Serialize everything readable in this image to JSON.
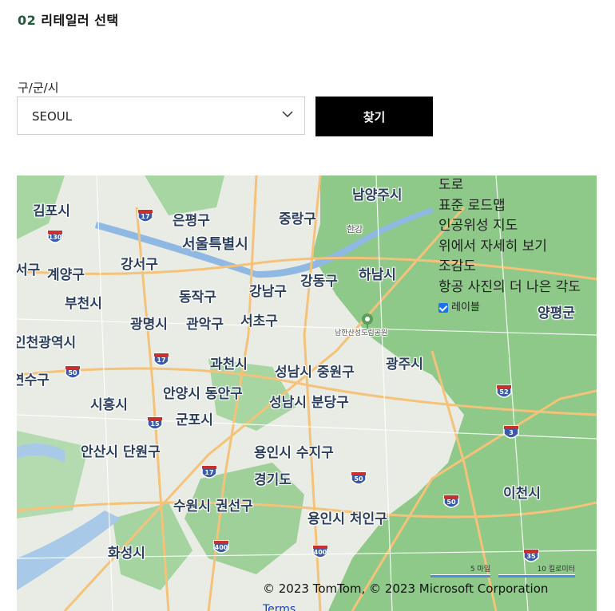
{
  "section": {
    "number": "02",
    "title": "리테일러 선택"
  },
  "filter": {
    "label": "구/군/시",
    "selected": "SEOUL",
    "find_button": "찾기"
  },
  "map": {
    "places": [
      {
        "name": "김포시"
      },
      {
        "name": "은평구"
      },
      {
        "name": "중랑구"
      },
      {
        "name": "남양주시"
      },
      {
        "name": "서울특별시"
      },
      {
        "name": "강서구"
      },
      {
        "name": "계양구"
      },
      {
        "name": "서구"
      },
      {
        "name": "하남시"
      },
      {
        "name": "강동구"
      },
      {
        "name": "동작구"
      },
      {
        "name": "강남구"
      },
      {
        "name": "부천시"
      },
      {
        "name": "광명시"
      },
      {
        "name": "관악구"
      },
      {
        "name": "서초구"
      },
      {
        "name": "양평군"
      },
      {
        "name": "인천광역시"
      },
      {
        "name": "과천시"
      },
      {
        "name": "성남시 중원구"
      },
      {
        "name": "광주시"
      },
      {
        "name": "연수구"
      },
      {
        "name": "안양시 동안구"
      },
      {
        "name": "시흥시"
      },
      {
        "name": "성남시 분당구"
      },
      {
        "name": "군포시"
      },
      {
        "name": "안산시 단원구"
      },
      {
        "name": "용인시 수지구"
      },
      {
        "name": "경기도"
      },
      {
        "name": "이천시"
      },
      {
        "name": "수원시 권선구"
      },
      {
        "name": "용인시 처인구"
      },
      {
        "name": "화성시"
      },
      {
        "name": "한강"
      },
      {
        "name": "남한산성도립공원"
      }
    ],
    "shields": [
      "17",
      "130",
      "17",
      "50",
      "17",
      "52",
      "3",
      "15",
      "17",
      "50",
      "50",
      "400",
      "400",
      "35"
    ],
    "menu": [
      "도로",
      "표준 로드맵",
      "인공위성 지도",
      "위에서 자세히 보기",
      "조감도",
      "항공 사진의 더 나은 각도"
    ],
    "labels_toggle": "레이블",
    "scale": {
      "miles": "5 마일",
      "km": "10 킬로미터"
    },
    "copyright": "© 2023 TomTom, © 2023 Microsoft Corporation",
    "terms": "Terms"
  }
}
